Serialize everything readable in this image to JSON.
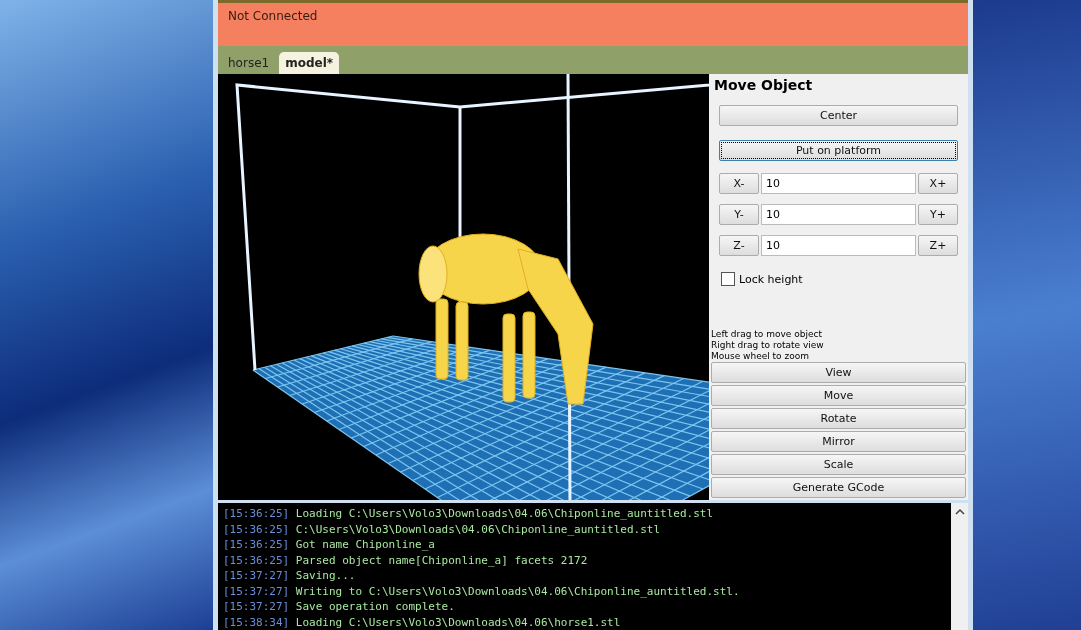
{
  "status_bar": {
    "text": "Not Connected",
    "connected": false
  },
  "tabs": [
    {
      "label": "horse1",
      "selected": false
    },
    {
      "label": "model*",
      "selected": true
    }
  ],
  "panel": {
    "title": "Move Object",
    "buttons": [
      {
        "label": "Center",
        "focused": false
      },
      {
        "label": "Put on platform",
        "focused": true
      }
    ],
    "axes": [
      {
        "minus": "X-",
        "value": "10",
        "plus": "X+"
      },
      {
        "minus": "Y-",
        "value": "10",
        "plus": "Y+"
      },
      {
        "minus": "Z-",
        "value": "10",
        "plus": "Z+"
      }
    ],
    "lock_height": {
      "label": "Lock height",
      "checked": false
    },
    "hints": [
      "Left drag to move object",
      "Right drag to rotate view",
      "Mouse wheel to zoom"
    ],
    "modes": [
      "View",
      "Move",
      "Rotate",
      "Mirror",
      "Scale",
      "Generate GCode"
    ]
  },
  "log": [
    {
      "time": "[15:36:25]",
      "message": "Loading C:\\Users\\Volo3\\Downloads\\04.06\\Chiponline_auntitled.stl"
    },
    {
      "time": "[15:36:25]",
      "message": "C:\\Users\\Volo3\\Downloads\\04.06\\Chiponline_auntitled.stl"
    },
    {
      "time": "[15:36:25]",
      "message": "Got name Chiponline_a"
    },
    {
      "time": "[15:36:25]",
      "message": "Parsed object name[Chiponline_a] facets 2172"
    },
    {
      "time": "[15:37:27]",
      "message": "Saving..."
    },
    {
      "time": "[15:37:27]",
      "message": "Writing to C:\\Users\\Volo3\\Downloads\\04.06\\Chiponline_auntitled.stl."
    },
    {
      "time": "[15:37:27]",
      "message": "Save operation complete."
    },
    {
      "time": "[15:38:34]",
      "message": "Loading C:\\Users\\Volo3\\Downloads\\04.06\\horse1.stl"
    }
  ]
}
